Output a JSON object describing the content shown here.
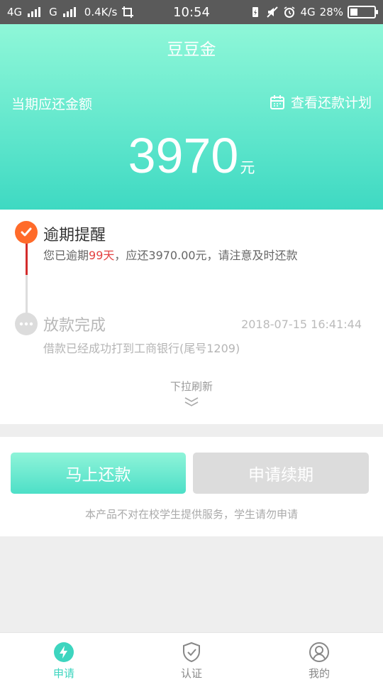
{
  "status_bar": {
    "network1": "4G",
    "network2": "G",
    "speed": "0.4K/s",
    "time": "10:54",
    "network3": "4G",
    "battery": "28%"
  },
  "header": {
    "title": "豆豆金",
    "amount_label": "当期应还金额",
    "plan_link": "查看还款计划",
    "amount": "3970",
    "unit": "元"
  },
  "timeline": [
    {
      "title": "逾期提醒",
      "desc_prefix": "您已逾期",
      "desc_highlight": "99天",
      "desc_suffix": "，应还3970.00元，请注意及时还款"
    },
    {
      "title": "放款完成",
      "time": "2018-07-15 16:41:44",
      "desc": "借款已经成功打到工商银行(尾号1209)"
    }
  ],
  "pull_refresh": "下拉刷新",
  "actions": {
    "repay": "马上还款",
    "extend": "申请续期",
    "notice": "本产品不对在校学生提供服务，学生请勿申请"
  },
  "nav": [
    {
      "label": "申请",
      "icon": "lightning-icon"
    },
    {
      "label": "认证",
      "icon": "shield-check-icon"
    },
    {
      "label": "我的",
      "icon": "user-icon"
    }
  ],
  "colors": {
    "accent": "#3dd5bf",
    "warning": "#ff6b2a",
    "overdue_red": "#e34242"
  }
}
